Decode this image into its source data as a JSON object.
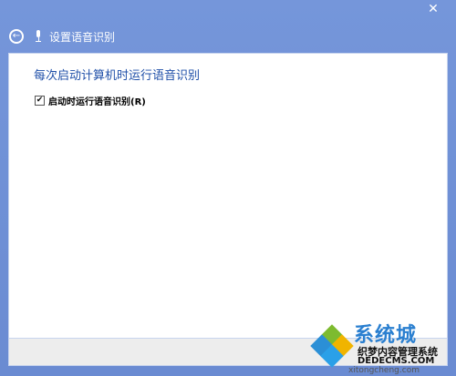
{
  "window": {
    "title": "设置语音识别",
    "close_glyph": "✕",
    "back_glyph": "←"
  },
  "content": {
    "heading": "每次启动计算机时运行语音识别",
    "checkbox": {
      "label": "启动时运行语音识别(R)",
      "checked": true,
      "check_glyph": "✔"
    }
  },
  "watermark": {
    "brand": "系统城",
    "text": "织梦内容管理系统",
    "site": "DEDECMS.COM",
    "url": "xitongcheng.com"
  },
  "colors": {
    "titlebar": "#6f8fd4",
    "heading": "#1f4fa8",
    "bottom_bar": "#ededed"
  }
}
